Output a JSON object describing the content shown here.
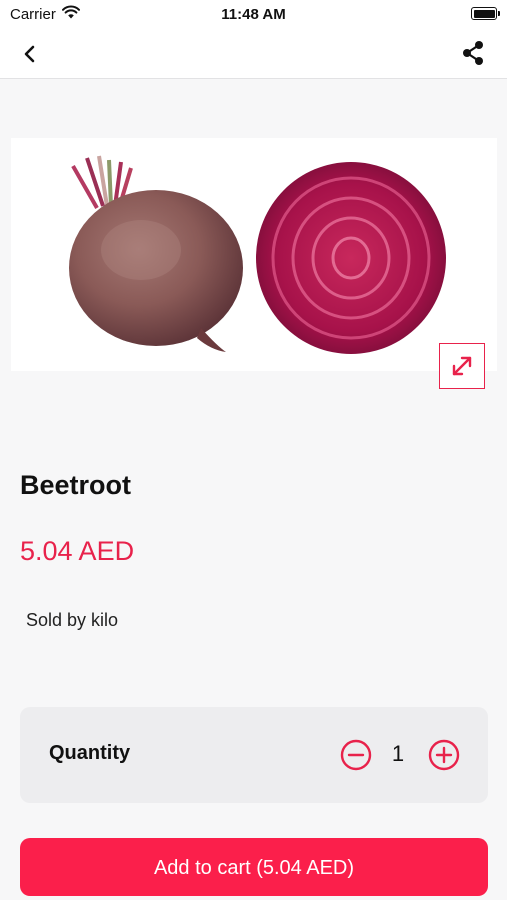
{
  "status_bar": {
    "carrier": "Carrier",
    "time": "11:48 AM"
  },
  "nav": {
    "back_icon": "chevron-left-icon",
    "share_icon": "share-icon"
  },
  "product": {
    "image_subject": "Beetroot",
    "expand_icon": "expand-diagonal-icon",
    "name": "Beetroot",
    "price": "5.04 AED",
    "sold_by": "Sold by kilo"
  },
  "quantity": {
    "label": "Quantity",
    "value": "1",
    "minus_icon": "minus-circle-icon",
    "plus_icon": "plus-circle-icon"
  },
  "cart_button": {
    "label": "Add to cart (5.04 AED)"
  },
  "colors": {
    "accent": "#e8224b",
    "button": "#fb1f4b",
    "background": "#f7f7f8",
    "card": "#ededef"
  }
}
